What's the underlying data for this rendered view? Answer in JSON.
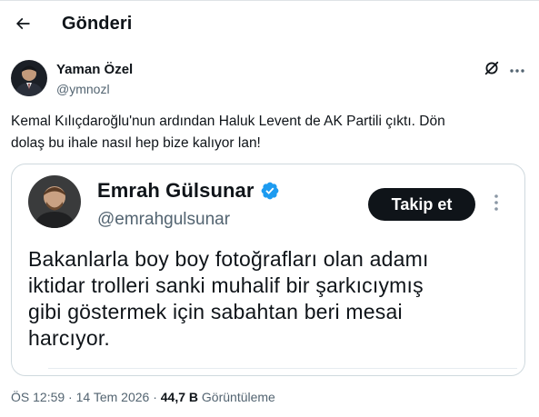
{
  "header": {
    "title": "Gönderi"
  },
  "tweet": {
    "author": {
      "name": "Yaman Özel",
      "handle": "@ymnozl"
    },
    "text_line1": "Kemal Kılıçdaroğlu'nun ardından Haluk Levent de AK Partili çıktı. Dön",
    "text_line2": "dolaş bu ihale nasıl hep bize kalıyor lan!",
    "embed": {
      "name": "Emrah Gülsunar",
      "handle": "@emrahgulsunar",
      "follow_label": "Takip et",
      "text_line1": "Bakanlarla boy boy fotoğrafları olan adamı",
      "text_line2": "iktidar trolleri sanki muhalif bir şarkıcıymış",
      "text_line3": "gibi göstermek için sabahtan beri mesai",
      "text_line4": "harcıyor."
    },
    "meta": {
      "time": "ÖS 12:59",
      "date": "14 Tem 2026",
      "separator": "·",
      "views_count": "44,7 B",
      "views_label": "Görüntüleme"
    }
  },
  "colors": {
    "text_primary": "#0f1419",
    "text_secondary": "#536471",
    "border": "#cfd9de",
    "verified_blue": "#1d9bf0"
  },
  "icons": {
    "back": "arrow-left-icon",
    "grok": "grok-icon",
    "more": "more-horizontal-icon",
    "verified": "verified-badge-icon",
    "embed_more": "more-vertical-icon"
  }
}
